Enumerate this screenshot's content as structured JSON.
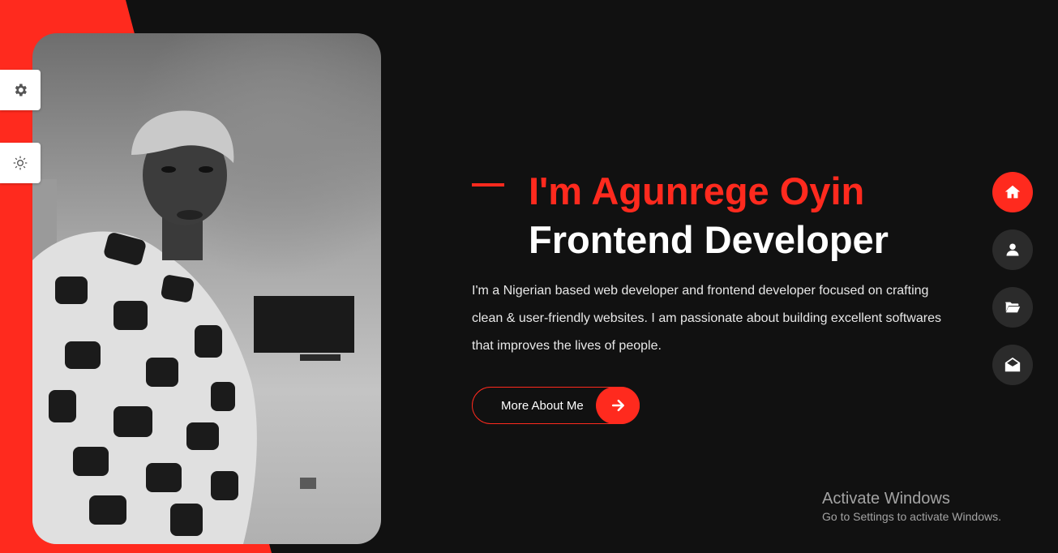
{
  "colors": {
    "accent": "#ff2a1e",
    "background": "#111111",
    "nav_inactive": "#2b2b2b"
  },
  "sidebar_controls": {
    "settings_icon": "gear-icon",
    "theme_icon": "sun-icon"
  },
  "hero": {
    "title": "I'm Agunrege Oyin",
    "subtitle": "Frontend Developer",
    "description": "I'm a Nigerian based web developer and frontend developer focused on crafting clean & user-friendly websites. I am passionate about building excellent softwares that improves the lives of people.",
    "cta_label": "More About Me",
    "cta_icon": "arrow-right-icon"
  },
  "nav": {
    "items": [
      {
        "icon": "home-icon",
        "active": true
      },
      {
        "icon": "user-icon",
        "active": false
      },
      {
        "icon": "folder-open-icon",
        "active": false
      },
      {
        "icon": "envelope-open-icon",
        "active": false
      }
    ]
  },
  "watermark": {
    "title": "Activate Windows",
    "subtitle": "Go to Settings to activate Windows."
  }
}
